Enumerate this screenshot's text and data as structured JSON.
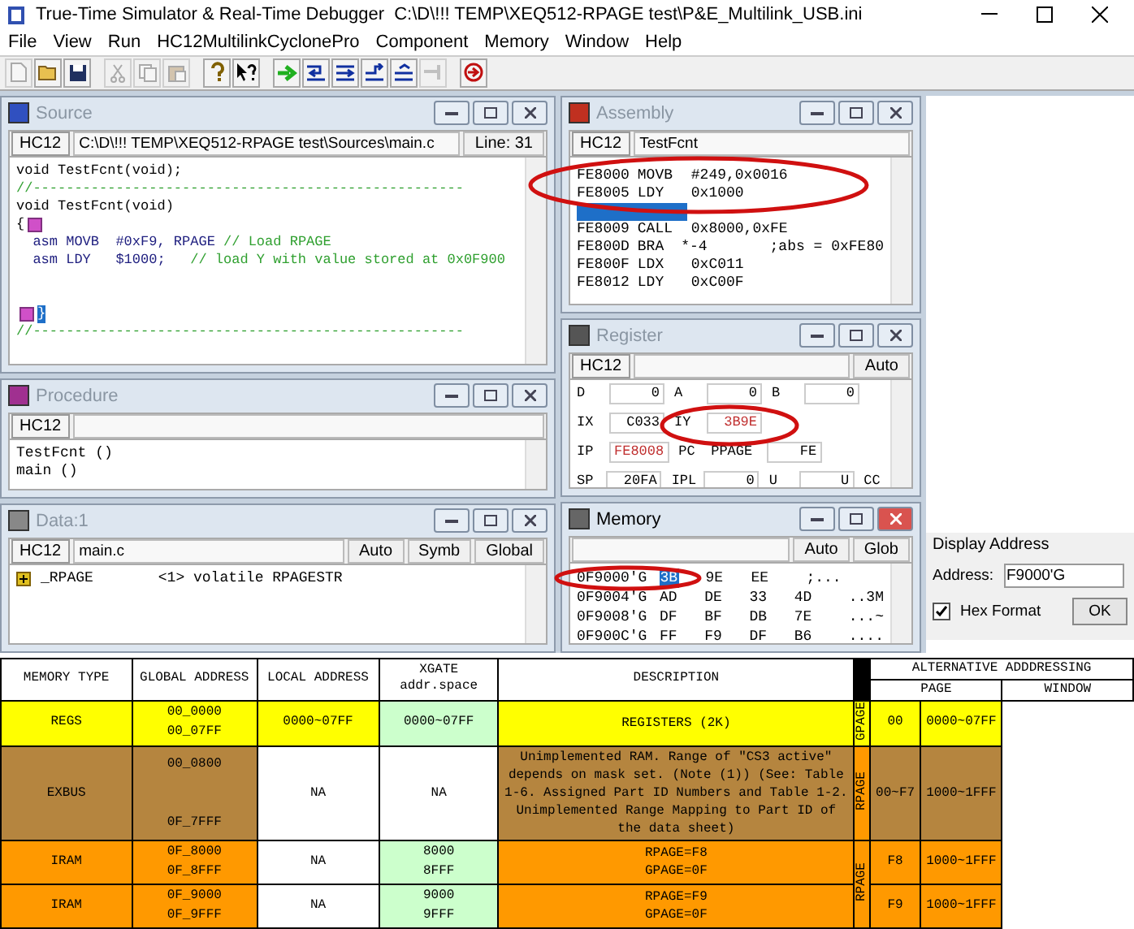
{
  "window": {
    "title": "True-Time Simulator & Real-Time Debugger",
    "path": "C:\\D\\!!! TEMP\\XEQ512-RPAGE test\\P&E_Multilink_USB.ini"
  },
  "menu": [
    "File",
    "View",
    "Run",
    "HC12MultilinkCyclonePro",
    "Component",
    "Memory",
    "Window",
    "Help"
  ],
  "toolbar": [
    {
      "kind": "new",
      "disabled": true
    },
    {
      "kind": "open",
      "disabled": false
    },
    {
      "kind": "save",
      "disabled": false
    },
    {
      "kind": "sep"
    },
    {
      "kind": "cut",
      "disabled": true
    },
    {
      "kind": "copy",
      "disabled": true
    },
    {
      "kind": "paste",
      "disabled": true
    },
    {
      "kind": "sep"
    },
    {
      "kind": "help",
      "disabled": false
    },
    {
      "kind": "context",
      "disabled": false
    },
    {
      "kind": "sep"
    },
    {
      "kind": "start",
      "disabled": false
    },
    {
      "kind": "step",
      "disabled": false
    },
    {
      "kind": "stepover",
      "disabled": false
    },
    {
      "kind": "stepout",
      "disabled": false
    },
    {
      "kind": "assemblystep",
      "disabled": false
    },
    {
      "kind": "halt",
      "disabled": true
    },
    {
      "kind": "sep"
    },
    {
      "kind": "reset",
      "disabled": false
    }
  ],
  "source": {
    "title": "Source",
    "active": false,
    "fields": [
      {
        "kind": "label",
        "text": "HC12"
      },
      {
        "kind": "field",
        "text": "C:\\D\\!!! TEMP\\XEQ512-RPAGE test\\Sources\\main.c"
      },
      {
        "kind": "button",
        "text": "Line: 31"
      }
    ],
    "lines": [
      {
        "kind": "code",
        "text": "void TestFcnt(void);",
        "selected": false
      },
      {
        "kind": "comment",
        "text": "//----------------------------------------------------",
        "selected": false
      },
      {
        "kind": "code",
        "text": "void TestFcnt(void)",
        "selected": false
      },
      {
        "kind": "code",
        "text": "{",
        "marker_after": true,
        "selected": false
      },
      {
        "kind": "asm",
        "code": "  asm MOVB  #0xF9, RPAGE ",
        "comment": "// Load RPAGE",
        "selected": false
      },
      {
        "kind": "asm",
        "code": "  asm LDY   $1000;   ",
        "comment": "// load Y with value stored at 0x0F900",
        "selected": false
      },
      {
        "kind": "blank"
      },
      {
        "kind": "blank"
      },
      {
        "kind": "code",
        "text": "}",
        "marker_before": true,
        "selected": true
      },
      {
        "kind": "comment",
        "text": "//----------------------------------------------------",
        "selected": false
      }
    ]
  },
  "procedure": {
    "title": "Procedure",
    "active": false,
    "fields": [
      {
        "kind": "label",
        "text": "HC12"
      },
      {
        "kind": "field"
      }
    ],
    "lines": [
      "TestFcnt ()",
      "main ()"
    ]
  },
  "data": {
    "title": "Data:1",
    "active": false,
    "fields": [
      {
        "kind": "label",
        "text": "HC12"
      },
      {
        "kind": "field",
        "text": "main.c"
      },
      {
        "kind": "button",
        "text": "Auto"
      },
      {
        "kind": "button",
        "text": "Symb"
      },
      {
        "kind": "button",
        "text": "Global"
      }
    ],
    "rows": [
      {
        "name": "_RPAGE",
        "value": "<1> volatile RPAGESTR",
        "expanded": false
      }
    ]
  },
  "assembly": {
    "title": "Assembly",
    "active": false,
    "fields": [
      {
        "kind": "label",
        "text": "HC12"
      },
      {
        "kind": "field",
        "text": "TestFcnt"
      }
    ],
    "rows": [
      {
        "address": "FE8000",
        "op": "MOVB",
        "operand": "#249,0x0016",
        "selected": false
      },
      {
        "address": "FE8005",
        "op": "LDY",
        "operand": "0x1000",
        "selected": false
      },
      {
        "selected": true
      },
      {
        "address": "FE8009",
        "op": "CALL",
        "operand": "0x8000,0xFE",
        "selected": false
      },
      {
        "address": "FE800D",
        "op": "BRA",
        "operand": "*-4",
        "comment": ";abs = 0xFE80",
        "selected": false
      },
      {
        "address": "FE800F",
        "op": "LDX",
        "operand": "0xC011",
        "selected": false
      },
      {
        "address": "FE8012",
        "op": "LDY",
        "operand": "0xC00F",
        "selected": false
      }
    ]
  },
  "register": {
    "title": "Register",
    "active": false,
    "fields": [
      {
        "kind": "label",
        "text": "HC12"
      },
      {
        "kind": "field"
      },
      {
        "kind": "button",
        "text": "Auto"
      }
    ],
    "rows": [
      [
        {
          "name": "D",
          "value": "0",
          "changed": false
        },
        {
          "name": "A",
          "value": "0",
          "changed": false
        },
        {
          "name": "B",
          "value": "0",
          "changed": false
        }
      ],
      [
        {
          "name": "IX",
          "value": "C033",
          "changed": false
        },
        {
          "name": "IY",
          "value": "3B9E",
          "changed": true
        }
      ],
      [
        {
          "name": "IP",
          "value": "FE8008",
          "changed": true
        },
        {
          "name": "PC"
        },
        {
          "name": "PPAGE",
          "value": "FE",
          "changed": false
        }
      ],
      [
        {
          "name": "SP",
          "value": "20FA",
          "changed": false
        },
        {
          "name": "IPL",
          "value": "0",
          "changed": false
        },
        {
          "name": "U",
          "value": "U",
          "changed": false
        },
        {
          "name": "CC"
        }
      ]
    ]
  },
  "memory": {
    "title": "Memory",
    "active": true,
    "fields": [
      {
        "kind": "field"
      },
      {
        "kind": "button",
        "text": "Auto"
      },
      {
        "kind": "button",
        "text": "Glob"
      }
    ],
    "rows": [
      {
        "address": "0F9000'G",
        "bytes": [
          {
            "text": "3B",
            "selected": true
          },
          {
            "text": "9E",
            "selected": false
          },
          {
            "text": "EE",
            "selected": false
          }
        ],
        "ascii": ";..."
      },
      {
        "address": "0F9004'G",
        "bytes": [
          {
            "text": "AD",
            "selected": false
          },
          {
            "text": "DE",
            "selected": false
          },
          {
            "text": "33",
            "selected": false
          },
          {
            "text": "4D",
            "selected": false
          }
        ],
        "ascii": "..3M"
      },
      {
        "address": "0F9008'G",
        "bytes": [
          {
            "text": "DF",
            "selected": false
          },
          {
            "text": "BF",
            "selected": false
          },
          {
            "text": "DB",
            "selected": false
          },
          {
            "text": "7E",
            "selected": false
          }
        ],
        "ascii": "...~"
      },
      {
        "address": "0F900C'G",
        "bytes": [
          {
            "text": "FF",
            "selected": false
          },
          {
            "text": "F9",
            "selected": false
          },
          {
            "text": "DF",
            "selected": false
          },
          {
            "text": "B6",
            "selected": false
          }
        ],
        "ascii": "...."
      }
    ]
  },
  "display_address": {
    "title": "Display Address",
    "label": "Address:",
    "value": "F9000'G",
    "checkbox": {
      "label": "Hex Format",
      "checked": true
    },
    "button": "OK"
  },
  "table": {
    "columns": [
      "MEMORY TYPE",
      "GLOBAL ADDRESS",
      "LOCAL ADDRESS",
      "XGATE\naddr.space",
      "DESCRIPTION"
    ],
    "group_title": "ALTERNATIVE ADDDRESSING",
    "sub_columns": [
      "PAGE",
      "WINDOW"
    ],
    "groups": [
      {
        "label": "GPAGE",
        "color": "#ffff00",
        "rows": [
          {
            "cells": [
              {
                "text": "REGS",
                "color": "#ffff00"
              },
              {
                "text": "00_0000\n00_07FF",
                "color": "#ffff00"
              },
              {
                "text": "0000~07FF",
                "color": "#ffff00"
              },
              {
                "text": "0000~07FF",
                "color": "#ccffcc"
              },
              {
                "text": "REGISTERS (2K)",
                "color": "#ffff00"
              },
              {
                "text": "00",
                "color": "#ffff00"
              },
              {
                "text": "0000~07FF",
                "color": "#ffff00"
              }
            ]
          }
        ]
      },
      {
        "label": "RPAGE",
        "color": "#ff9900",
        "rows": [
          {
            "cells": [
              {
                "text": "EXBUS",
                "color": "#b5853f"
              },
              {
                "text": "00_0800\n\n\n0F_7FFF",
                "color": "#b5853f"
              },
              {
                "text": "NA",
                "color": "#ffffff"
              },
              {
                "text": "NA",
                "color": "#ffffff"
              },
              {
                "text": "Unimplemented RAM. Range of \"CS3 active\" depends on mask set.  (Note (1))  (See: Table 1-6. Assigned Part ID Numbers and Table 1-2. Unimplemented Range Mapping to Part ID of the data sheet)",
                "color": "#b5853f"
              },
              {
                "text": "00~F7",
                "color": "#b5853f"
              },
              {
                "text": "1000~1FFF",
                "color": "#b5853f"
              }
            ]
          }
        ]
      },
      {
        "label": "RPAGE",
        "color": "#ff9900",
        "rows": [
          {
            "cells": [
              {
                "text": "IRAM",
                "color": "#ff9900"
              },
              {
                "text": "0F_8000\n0F_8FFF",
                "color": "#ff9900"
              },
              {
                "text": "NA",
                "color": "#ffffff"
              },
              {
                "text": "8000\n8FFF",
                "color": "#ccffcc"
              },
              {
                "text": "RPAGE=F8\nGPAGE=0F",
                "color": "#ff9900"
              },
              {
                "text": "F8",
                "color": "#ff9900"
              },
              {
                "text": "1000~1FFF",
                "color": "#ff9900"
              }
            ]
          },
          {
            "cells": [
              {
                "text": "IRAM",
                "color": "#ff9900"
              },
              {
                "text": "0F_9000\n0F_9FFF",
                "color": "#ff9900"
              },
              {
                "text": "NA",
                "color": "#ffffff"
              },
              {
                "text": "9000\n9FFF",
                "color": "#ccffcc"
              },
              {
                "text": "RPAGE=F9\nGPAGE=0F",
                "color": "#ff9900"
              },
              {
                "text": "F9",
                "color": "#ff9900"
              },
              {
                "text": "1000~1FFF",
                "color": "#ff9900"
              }
            ]
          }
        ]
      }
    ]
  }
}
